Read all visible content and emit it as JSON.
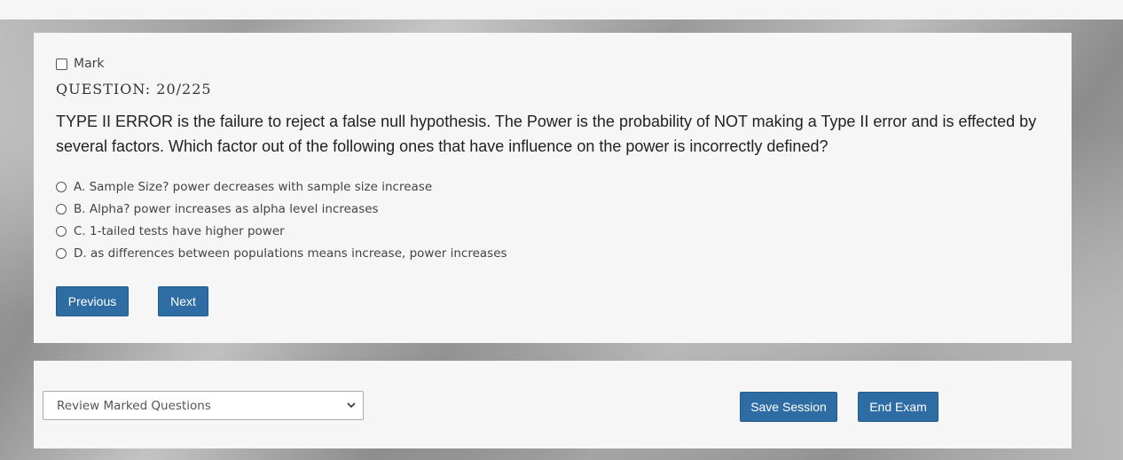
{
  "question": {
    "mark_label": "Mark",
    "number": "QUESTION: 20/225",
    "text": "TYPE II ERROR is the failure to reject a false null hypothesis. The Power is the probability of NOT making a Type II error and is effected by several factors. Which factor out of the following ones that have influence on the power is incorrectly defined?",
    "options": [
      "A. Sample Size? power decreases with sample size increase",
      "B. Alpha? power increases as alpha level increases",
      "C. 1-tailed tests have higher power",
      "D. as differences between populations means increase, power increases"
    ],
    "previous_label": "Previous",
    "next_label": "Next"
  },
  "footer": {
    "review_select_value": "Review Marked Questions",
    "save_label": "Save Session",
    "end_label": "End Exam"
  },
  "colors": {
    "button_bg": "#2e6da4",
    "panel_bg": "#f6f6f6"
  }
}
